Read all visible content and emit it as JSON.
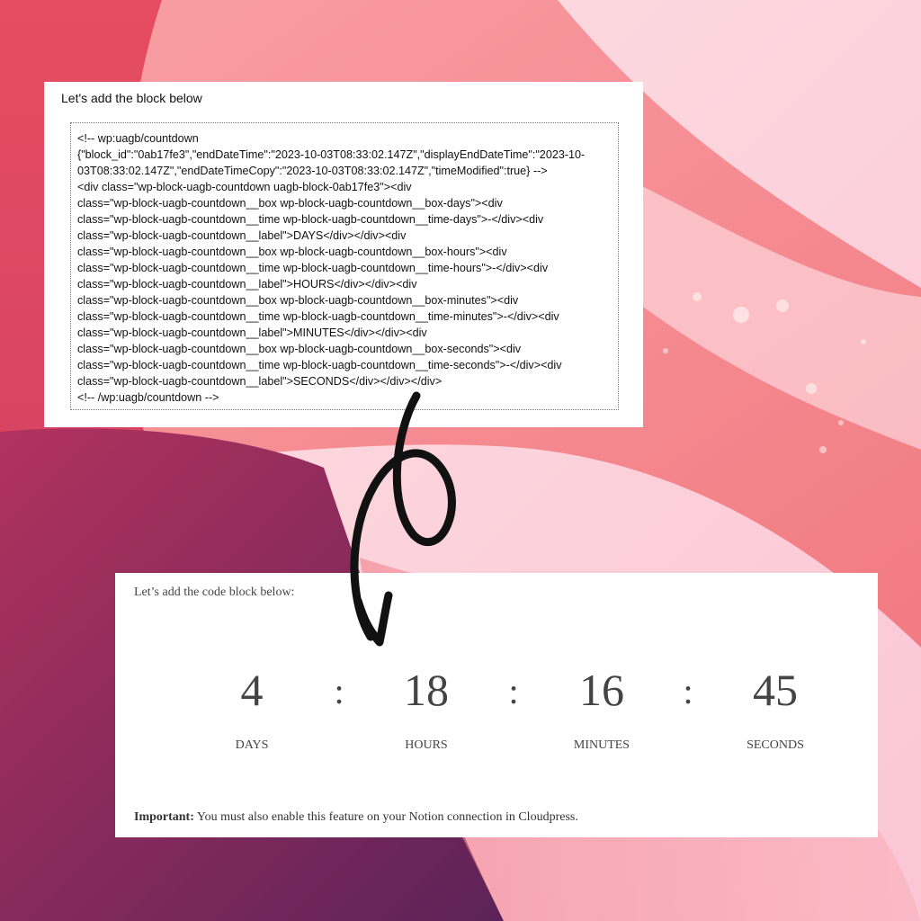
{
  "top_card": {
    "intro": "Let's add the block below",
    "code_lines": [
      "<!-- wp:uagb/countdown",
      "{\"block_id\":\"0ab17fe3\",\"endDateTime\":\"2023-10-03T08:33:02.147Z\",\"displayEndDateTime\":\"2023-10-",
      "03T08:33:02.147Z\",\"endDateTimeCopy\":\"2023-10-03T08:33:02.147Z\",\"timeModified\":true} -->",
      "<div class=\"wp-block-uagb-countdown uagb-block-0ab17fe3\"><div",
      "class=\"wp-block-uagb-countdown__box wp-block-uagb-countdown__box-days\"><div",
      "class=\"wp-block-uagb-countdown__time wp-block-uagb-countdown__time-days\">-</div><div",
      "class=\"wp-block-uagb-countdown__label\">DAYS</div></div><div",
      "class=\"wp-block-uagb-countdown__box wp-block-uagb-countdown__box-hours\"><div",
      "class=\"wp-block-uagb-countdown__time wp-block-uagb-countdown__time-hours\">-</div><div",
      "class=\"wp-block-uagb-countdown__label\">HOURS</div></div><div",
      "class=\"wp-block-uagb-countdown__box wp-block-uagb-countdown__box-minutes\"><div",
      "class=\"wp-block-uagb-countdown__time wp-block-uagb-countdown__time-minutes\">-</div><div",
      "class=\"wp-block-uagb-countdown__label\">MINUTES</div></div><div",
      "class=\"wp-block-uagb-countdown__box wp-block-uagb-countdown__box-seconds\"><div",
      "class=\"wp-block-uagb-countdown__time wp-block-uagb-countdown__time-seconds\">-</div><div",
      "class=\"wp-block-uagb-countdown__label\">SECONDS</div></div></div>",
      "<!-- /wp:uagb/countdown -->"
    ]
  },
  "bottom_card": {
    "intro": "Let’s add the code block below:",
    "countdown": {
      "days": {
        "value": "4",
        "label": "DAYS"
      },
      "hours": {
        "value": "18",
        "label": "HOURS"
      },
      "minutes": {
        "value": "16",
        "label": "MINUTES"
      },
      "seconds": {
        "value": "45",
        "label": "SECONDS"
      },
      "separator": ":"
    },
    "note_strong": "Important:",
    "note_text": " You must also enable this feature on your Notion connection in Cloudpress."
  },
  "colors": {
    "bg_light": "#fbd0d3",
    "bg_pink": "#f48a92",
    "bg_red": "#e0445c",
    "bg_purple": "#6e2a5e",
    "arrow": "#111111"
  },
  "icons": {
    "arrow": "curly-arrow-icon"
  }
}
